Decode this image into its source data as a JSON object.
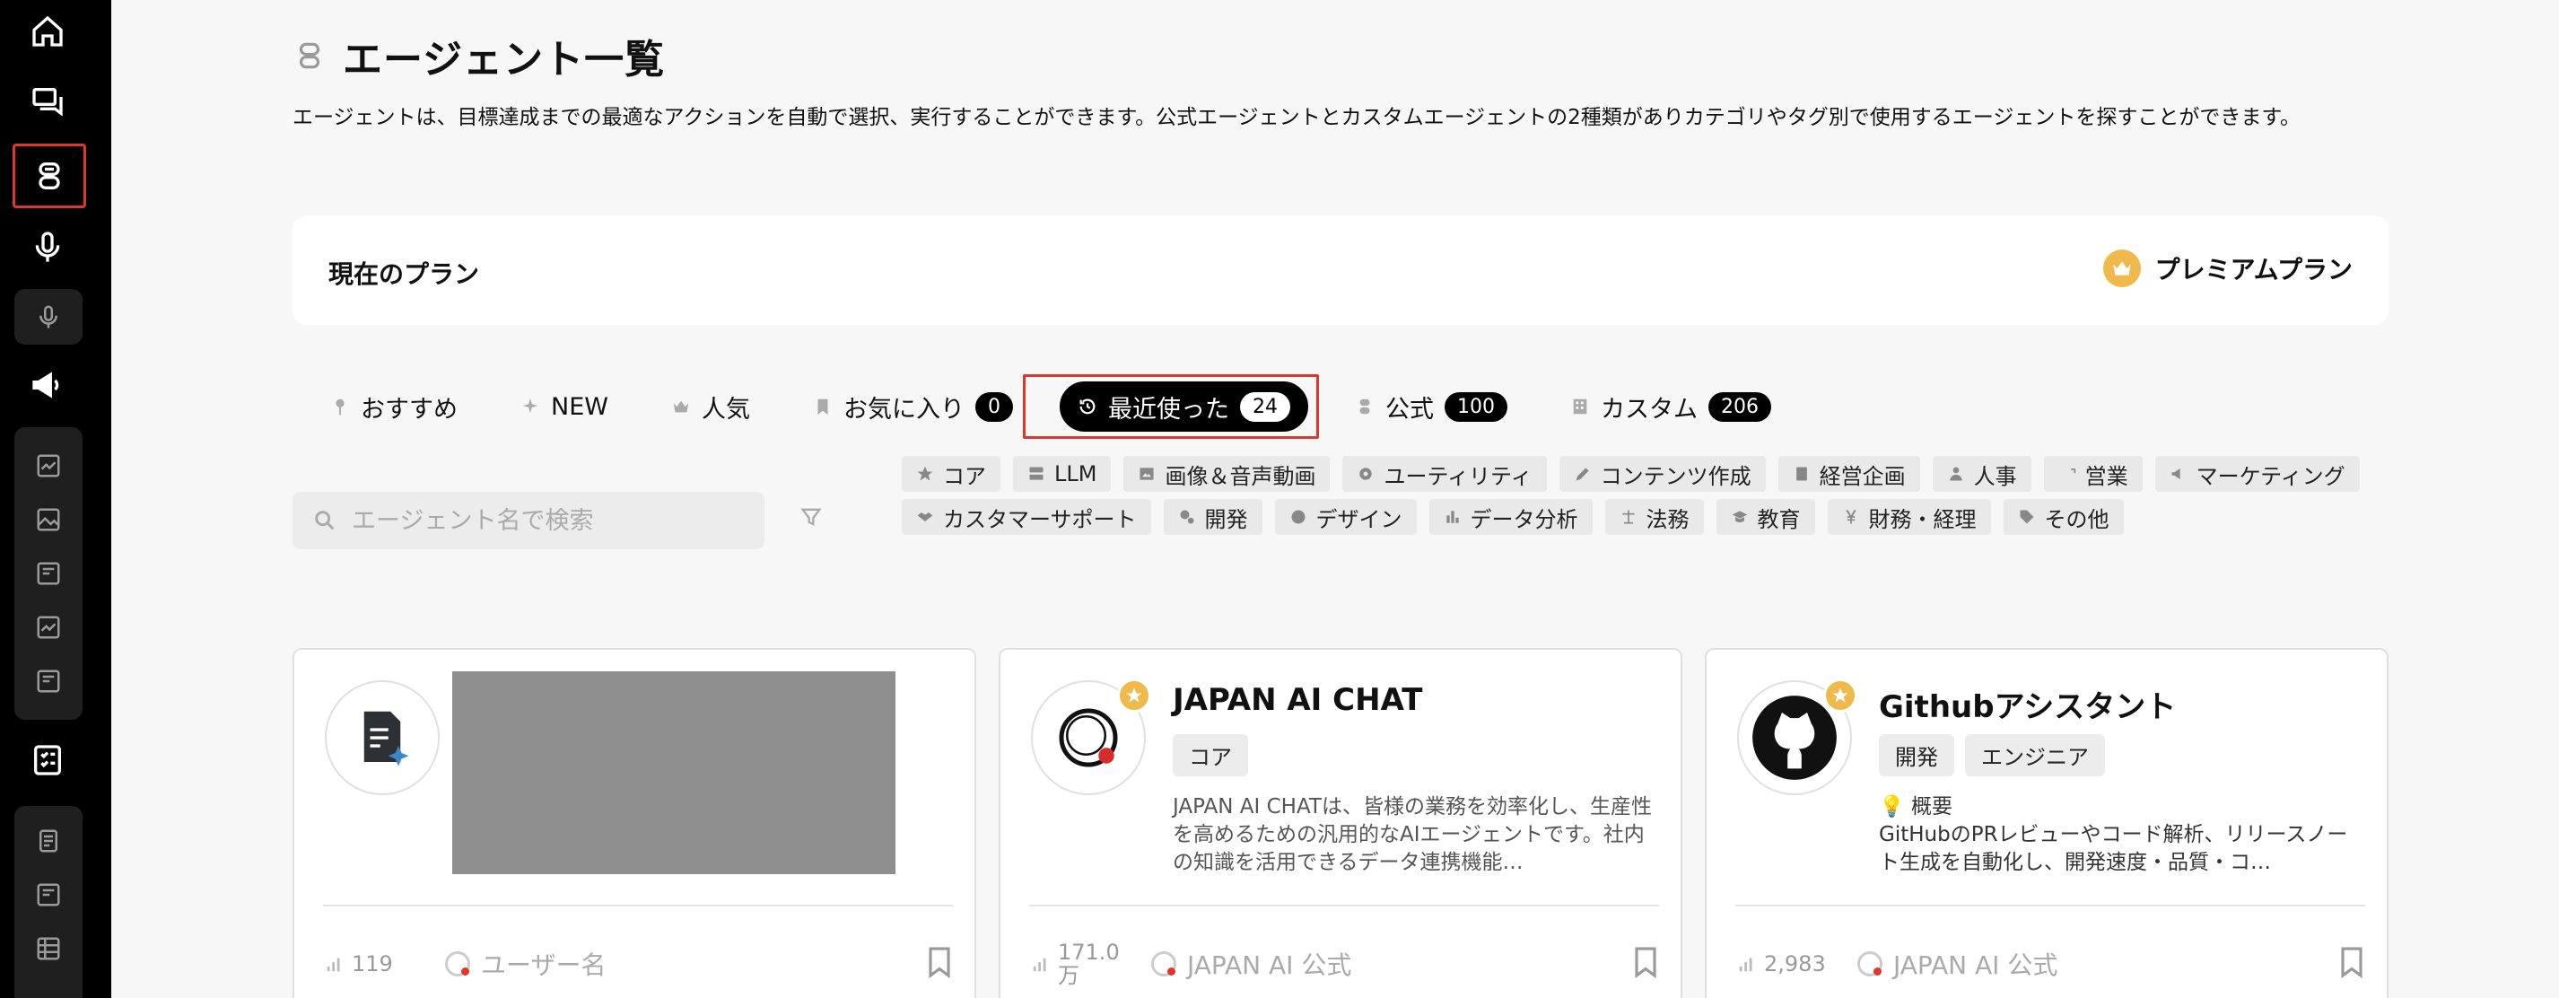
{
  "page": {
    "title": "エージェント一覧",
    "description": "エージェントは、目標達成までの最適なアクションを自動で選択、実行することができます。公式エージェントとカスタムエージェントの2種類がありカテゴリやタグ別で使用するエージェントを探すことができます。"
  },
  "plan": {
    "label": "現在のプラン",
    "name": "プレミアムプラン"
  },
  "tabs": [
    {
      "label": "おすすめ",
      "icon": "pin-icon"
    },
    {
      "label": "NEW",
      "icon": "sparkle-icon"
    },
    {
      "label": "人気",
      "icon": "crown-icon"
    },
    {
      "label": "お気に入り",
      "icon": "bookmark-icon",
      "count": "0"
    },
    {
      "label": "最近使った",
      "icon": "history-icon",
      "count": "24",
      "active": true
    },
    {
      "label": "公式",
      "icon": "robot-icon",
      "count": "100"
    },
    {
      "label": "カスタム",
      "icon": "building-icon",
      "count": "206"
    }
  ],
  "search": {
    "placeholder": "エージェント名で検索"
  },
  "categories": [
    "コア",
    "LLM",
    "画像＆音声動画",
    "ユーティリティ",
    "コンテンツ作成",
    "経営企画",
    "人事",
    "営業",
    "マーケティング",
    "カスタマーサポート",
    "開発",
    "デザイン",
    "データ分析",
    "法務",
    "教育",
    "財務・経理",
    "その他"
  ],
  "cards": [
    {
      "title": "",
      "tags": [],
      "description": "",
      "usage": "119",
      "author": "ユーザー名"
    },
    {
      "title": "JAPAN AI CHAT",
      "tags": [
        "コア"
      ],
      "description": "JAPAN AI CHATは、皆様の業務を効率化し、生産性を高めるための汎用的なAIエージェントです。社内の知識を活用できるデータ連携機能…",
      "usage_line1": "171.0",
      "usage_line2": "万",
      "author": "JAPAN AI 公式"
    },
    {
      "title": "Githubアシスタント",
      "tags": [
        "開発",
        "エンジニア"
      ],
      "hint": "💡 概要",
      "description": "GitHubのPRレビューやコード解析、リリースノート生成を自動化し、開発速度・品質・コ…",
      "usage": "2,983",
      "author": "JAPAN AI 公式"
    }
  ],
  "colors": {
    "sidebar": "#000000",
    "highlight": "#e0372d",
    "accent": "#f0b94b"
  }
}
